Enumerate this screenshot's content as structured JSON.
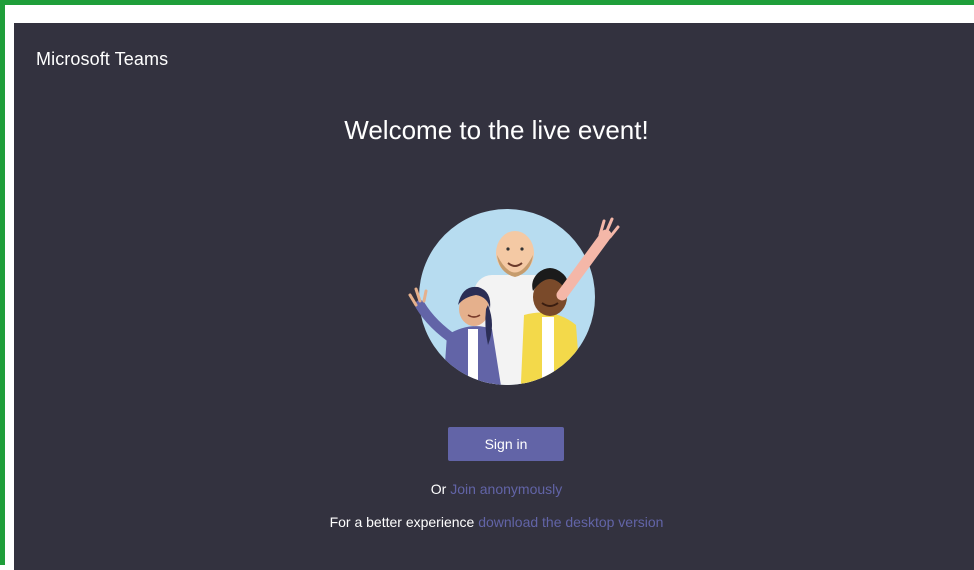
{
  "app": {
    "title": "Microsoft Teams"
  },
  "main": {
    "heading": "Welcome to the live event!",
    "sign_in_label": "Sign in",
    "or_prefix": "Or",
    "join_anonymously_label": "Join anonymously",
    "better_prefix": "For a better experience",
    "download_desktop_label": "download the desktop version"
  },
  "colors": {
    "background": "#33323f",
    "accent": "#6264a7",
    "frame_border": "#1f9e3a",
    "text": "#ffffff"
  }
}
